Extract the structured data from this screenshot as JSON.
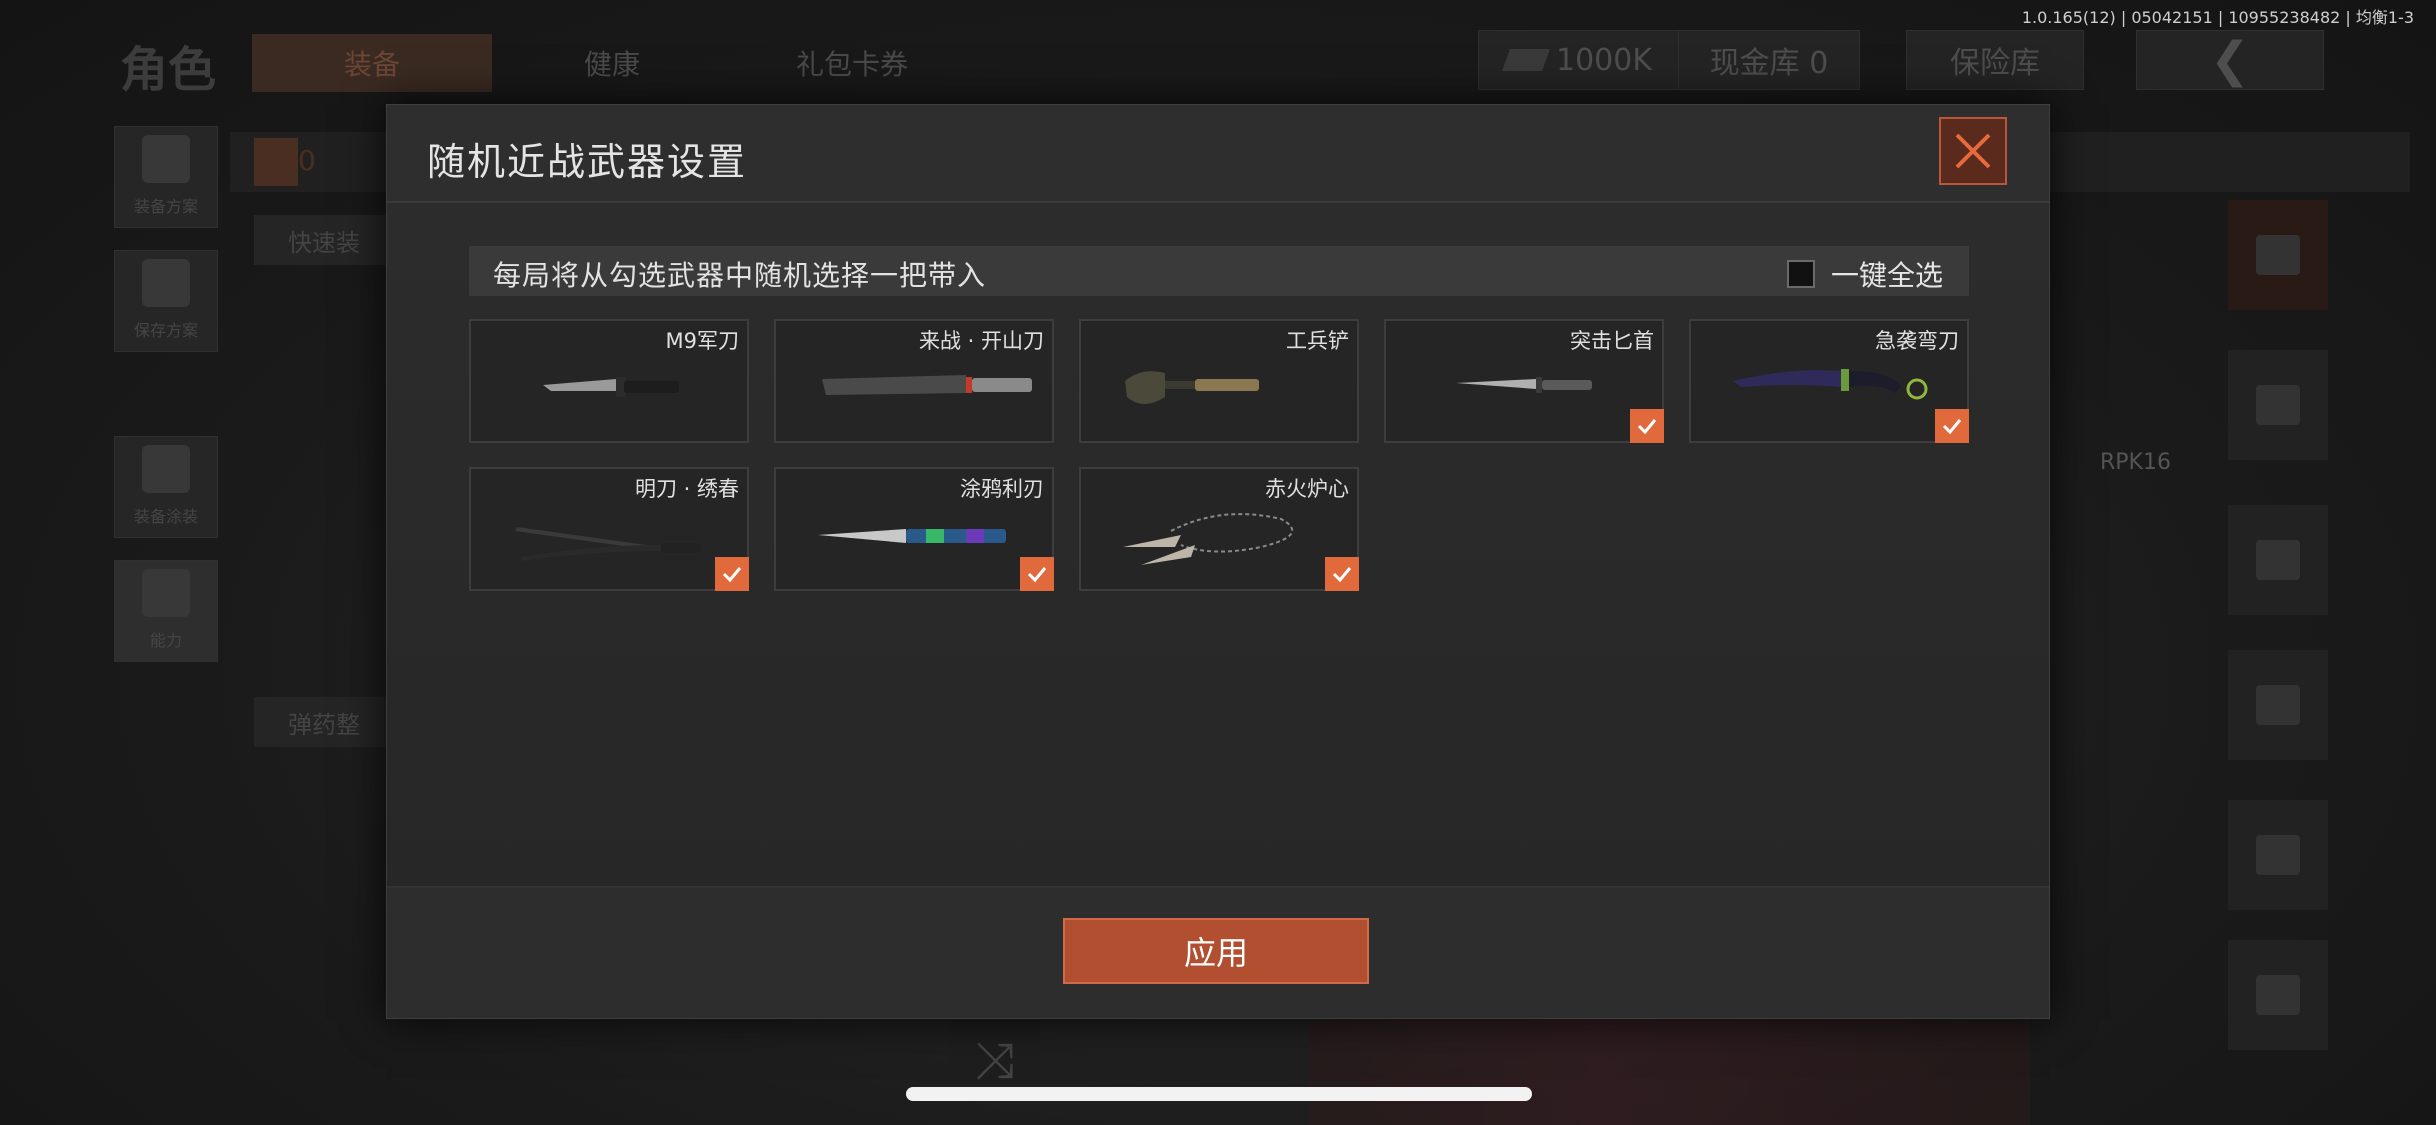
{
  "version": "1.0.165(12) | 05042151 | 10955238482 | 均衡1-3",
  "background": {
    "title": "角色",
    "tabs": [
      "装备",
      "健康",
      "礼包卡券"
    ],
    "currency": "1000K",
    "cash_vault": "现金库 0",
    "safe_box": "保险库",
    "side_items": [
      "装备方案",
      "保存方案",
      "装备涂装",
      "能力"
    ],
    "quick_equip": "快速装",
    "ammo": "弹药整",
    "armor_count": "0",
    "right_label": "RPK16"
  },
  "modal": {
    "title": "随机近战武器设置",
    "notice": "每局将从勾选武器中随机选择一把带入",
    "select_all": "一键全选",
    "apply": "应用"
  },
  "weapons": [
    {
      "name": "M9军刀",
      "checked": false
    },
    {
      "name": "来战 · 开山刀",
      "checked": false
    },
    {
      "name": "工兵铲",
      "checked": false
    },
    {
      "name": "突击匕首",
      "checked": true
    },
    {
      "name": "急袭弯刀",
      "checked": true
    },
    {
      "name": "明刀 · 绣春",
      "checked": true
    },
    {
      "name": "涂鸦利刃",
      "checked": true
    },
    {
      "name": "赤火炉心",
      "checked": true
    }
  ],
  "colors": {
    "accent": "#e06a3c",
    "apply": "#b24f31"
  }
}
